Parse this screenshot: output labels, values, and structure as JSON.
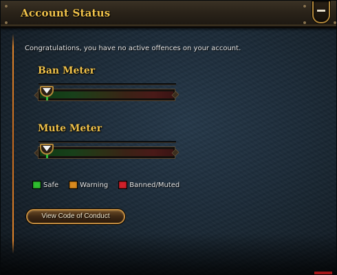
{
  "header": {
    "title": "Account Status",
    "collapse_icon": "minus-icon"
  },
  "status": {
    "message": "Congratulations, you have no active offences on your account."
  },
  "meters": [
    {
      "title": "Ban Meter",
      "level": 0.0
    },
    {
      "title": "Mute Meter",
      "level": 0.0
    }
  ],
  "legend": [
    {
      "label": "Safe",
      "color": "#2fbf2f"
    },
    {
      "label": "Warning",
      "color": "#d98a1e"
    },
    {
      "label": "Banned/Muted",
      "color": "#d0202a"
    }
  ],
  "actions": {
    "conduct_label": "View Code of Conduct"
  },
  "colors": {
    "accent_gold": "#f0c24a",
    "border_gold": "#b5893a",
    "panel_bg": "#1c2b38"
  }
}
